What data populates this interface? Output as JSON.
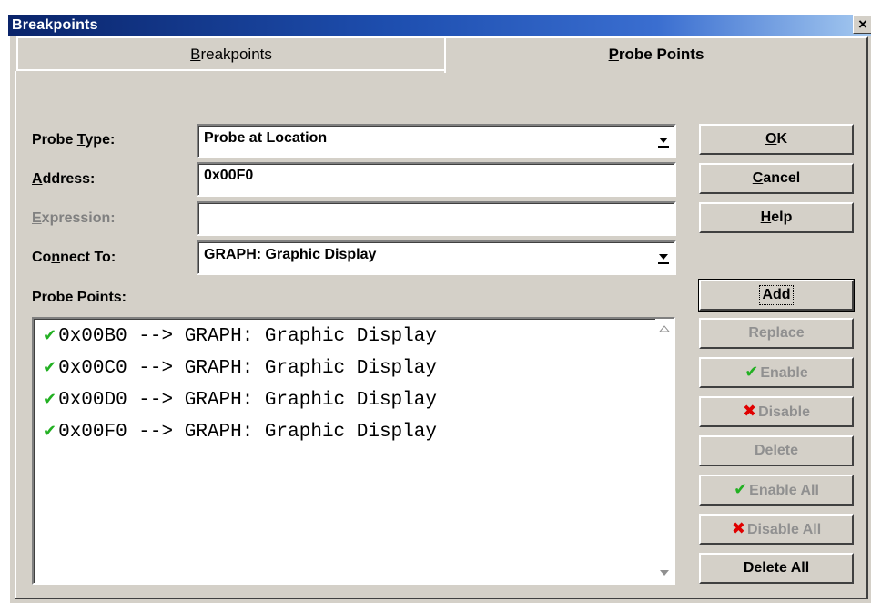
{
  "window": {
    "title": "Breakpoints",
    "close_label": "×"
  },
  "tabs": {
    "breakpoints": {
      "prefix": "",
      "accel": "B",
      "rest": "reakpoints"
    },
    "probe_points": {
      "prefix": "",
      "accel": "P",
      "rest": "robe Points"
    }
  },
  "form": {
    "probe_type": {
      "label_prefix": "Probe ",
      "label_accel": "T",
      "label_rest": "ype:",
      "value": "Probe at Location"
    },
    "address": {
      "label_prefix": "",
      "label_accel": "A",
      "label_rest": "ddress:",
      "value": "0x00F0"
    },
    "expression": {
      "label_prefix": "",
      "label_accel": "E",
      "label_rest": "xpression:",
      "value": ""
    },
    "connect_to": {
      "label_prefix": "Co",
      "label_accel": "n",
      "label_rest": "nect To:",
      "value": "GRAPH: Graphic Display"
    },
    "probe_points_label": "Probe Points:"
  },
  "probe_list": [
    {
      "text": "0x00B0 --> GRAPH: Graphic Display",
      "enabled": true
    },
    {
      "text": "0x00C0 --> GRAPH: Graphic Display",
      "enabled": true
    },
    {
      "text": "0x00D0 --> GRAPH: Graphic Display",
      "enabled": true
    },
    {
      "text": "0x00F0 --> GRAPH: Graphic Display",
      "enabled": true
    }
  ],
  "buttons": {
    "ok": {
      "accel": "O",
      "rest": "K"
    },
    "cancel": {
      "accel": "C",
      "rest": "ancel"
    },
    "help": {
      "accel": "H",
      "rest": "elp"
    },
    "add": "Add",
    "replace": "Replace",
    "enable": "Enable",
    "disable": "Disable",
    "delete": "Delete",
    "enable_all": "Enable All",
    "disable_all": "Disable All",
    "delete_all": "Delete All"
  },
  "icons": {
    "check": "✔",
    "cross": "✖"
  },
  "colors": {
    "title_start": "#0a246a",
    "title_end": "#a6caf0",
    "face": "#d4d0c8",
    "check": "#22b022",
    "cross": "#e00000"
  }
}
